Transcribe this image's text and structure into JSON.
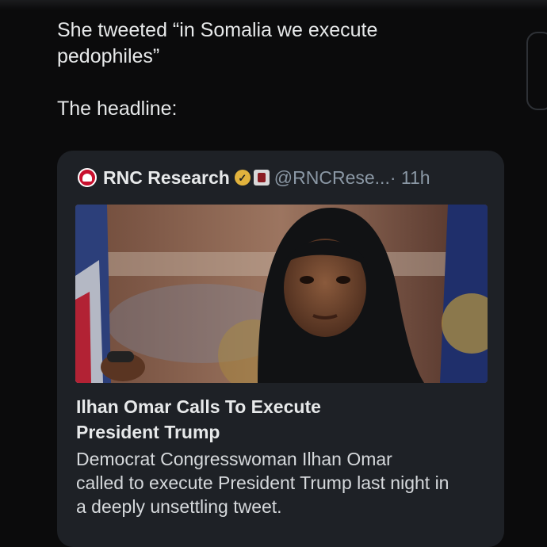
{
  "post": {
    "text_lines": [
      "She tweeted “in Somalia we execute",
      "pedophiles”",
      "The headline:"
    ]
  },
  "quoted_tweet": {
    "author_name": "RNC Research",
    "handle": "@RNCRese...",
    "timestamp": "· 11h",
    "title_lines": [
      "Ilhan Omar Calls To Execute",
      "President Trump"
    ],
    "description_lines": [
      "Democrat Congresswoman Ilhan Omar",
      "called to execute President Trump last night in",
      "a deeply unsettling tweet."
    ]
  },
  "icons": [
    "rnc-logo",
    "verified-badge-icon",
    "affiliate-badge-icon"
  ],
  "colors": {
    "background": "#0b0b0c",
    "card": "#1e2126",
    "text": "#e7e9ea",
    "muted": "#8b98a5",
    "verified_gold": "#e2b33d",
    "rnc_red": "#c8102e"
  }
}
